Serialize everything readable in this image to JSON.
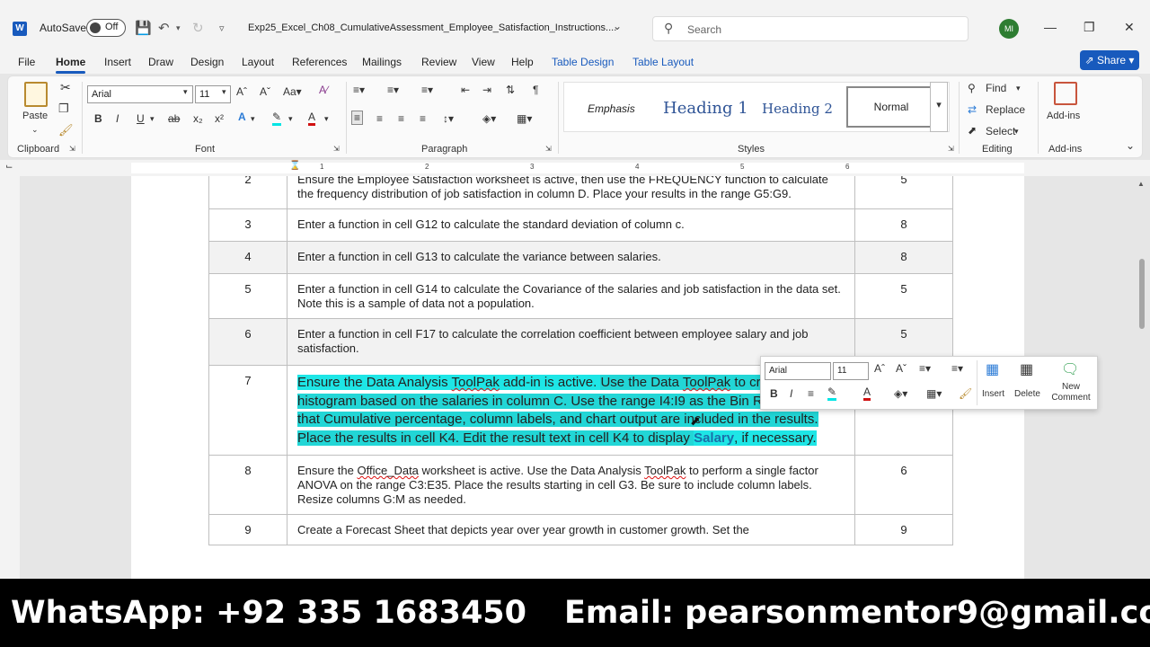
{
  "titlebar": {
    "autosave_label": "AutoSave",
    "autosave_state": "Off",
    "document_title": "Exp25_Excel_Ch08_CumulativeAssessment_Employee_Satisfaction_Instructions....",
    "search_placeholder": "Search",
    "user_initials": "MI"
  },
  "tabs": [
    "File",
    "Home",
    "Insert",
    "Draw",
    "Design",
    "Layout",
    "References",
    "Mailings",
    "Review",
    "View",
    "Help",
    "Table Design",
    "Table Layout"
  ],
  "share_label": "Share",
  "ribbon": {
    "clipboard": {
      "paste": "Paste",
      "label": "Clipboard"
    },
    "font": {
      "name": "Arial",
      "size": "11",
      "label": "Font"
    },
    "paragraph": {
      "label": "Paragraph"
    },
    "styles": {
      "items": [
        "Emphasis",
        "Heading 1",
        "Heading 2",
        "Normal"
      ],
      "label": "Styles"
    },
    "editing": {
      "find": "Find",
      "replace": "Replace",
      "select": "Select",
      "label": "Editing"
    },
    "addins": {
      "button": "Add-ins",
      "label": "Add-ins"
    }
  },
  "ruler_numbers": [
    "1",
    "2",
    "3",
    "4",
    "5",
    "6"
  ],
  "table_rows": [
    {
      "num": "2",
      "text": "Ensure the Employee Satisfaction worksheet is active, then use the FREQUENCY function to calculate the frequency distribution of job satisfaction in column D. Place your results in the range G5:G9.",
      "points": "5",
      "shade": false
    },
    {
      "num": "3",
      "text": "Enter a function in cell G12 to calculate the standard deviation of column c.",
      "points": "8",
      "shade": false
    },
    {
      "num": "4",
      "text": "Enter a function in cell G13 to calculate the variance between salaries.",
      "points": "8",
      "shade": true
    },
    {
      "num": "5",
      "text": "Enter a function in cell G14 to calculate the Covariance of the salaries and job satisfaction in the data set. Note this is a sample of data not a population.",
      "points": "5",
      "shade": false
    },
    {
      "num": "6",
      "text": "Enter a function in cell F17 to calculate the correlation coefficient between employee salary and job satisfaction.",
      "points": "5",
      "shade": true
    },
    {
      "num": "7",
      "points": "",
      "seg1": "Ensure the Data Analysis ",
      "seg2": "ToolPak",
      "seg3": " add-in is active. ",
      "seg4": "Use the Data ",
      "seg5": "ToolPak",
      "seg6": " to create a histogram based on the salaries in column C. Use the range I4:I9 as the Bin Range. Ensure that Cumulative percentage, column labels, and chart output are included in the results. Place the results in cell K4. Edit the result text in cell K4 to display ",
      "seg7": "Salary",
      "seg8": ", if necessary."
    },
    {
      "num": "8",
      "points": "6",
      "a": "Ensure the ",
      "b": "Office_Data",
      "c": " worksheet is active. Use the Data Analysis ",
      "d": "ToolPak",
      "e": " to perform a single factor ANOVA on the range C3:E35. Place the results starting in cell G3. Be sure to include column labels. Resize columns G:M as needed."
    },
    {
      "num": "9",
      "text": "Create a Forecast Sheet that depicts year over year growth in customer growth. Set the",
      "points": "9",
      "shade": false
    }
  ],
  "mini_toolbar": {
    "font": "Arial",
    "size": "11",
    "insert": "Insert",
    "delete": "Delete",
    "new_comment": "New Comment"
  },
  "banner": {
    "whatsapp": "WhatsApp: +92 335 1683450",
    "email": "Email: pearsonmentor9@gmail.com"
  },
  "colors": {
    "accent": "#185abd",
    "highlight": "#1ee6e6",
    "banner": "#000000"
  }
}
